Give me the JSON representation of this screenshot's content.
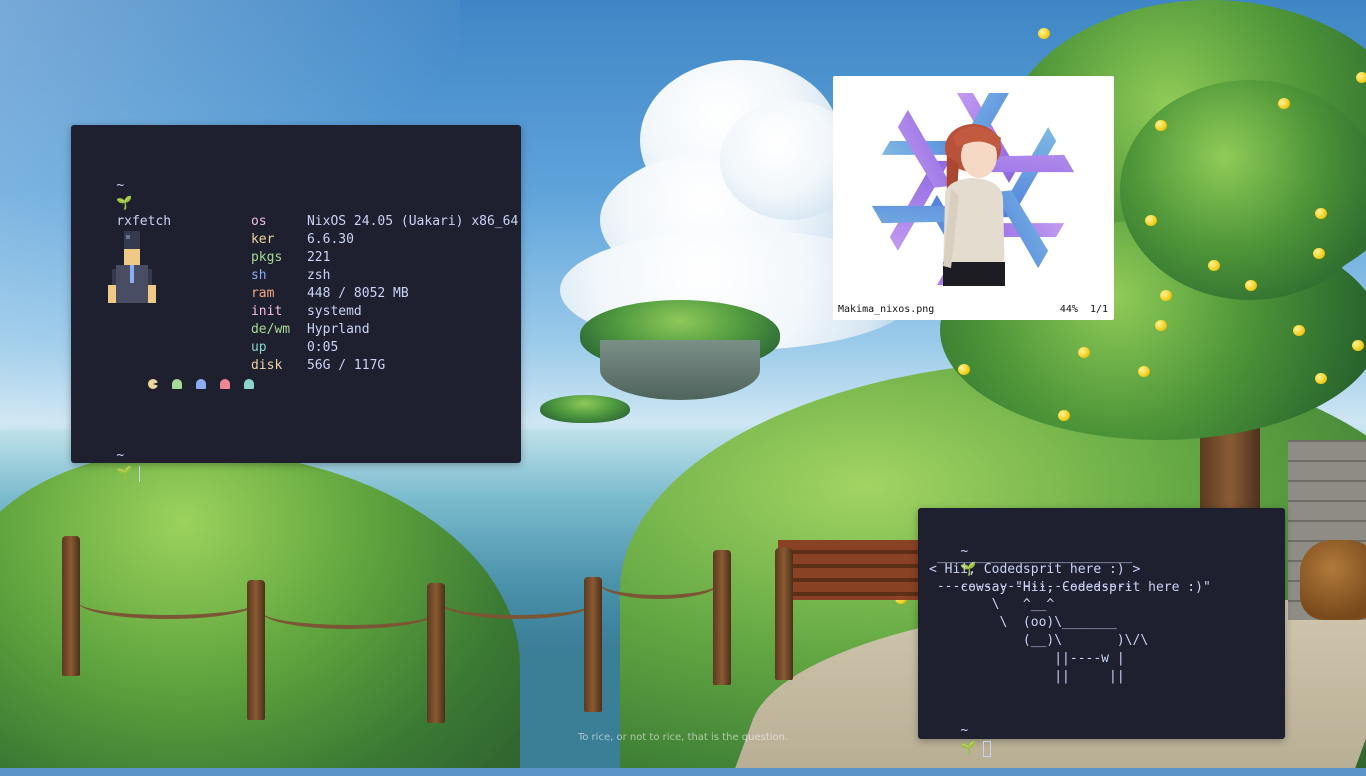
{
  "wallpaper": {
    "caption": "To rice, or not to rice, that is the question."
  },
  "terminal_fetch": {
    "prompt_symbol": "~",
    "prompt_icon": "sprout-icon",
    "command": "rxfetch",
    "info": [
      {
        "label": "os",
        "value": "NixOS 24.05 (Uakari) x86_64",
        "color": "#f5bde6"
      },
      {
        "label": "ker",
        "value": "6.6.30",
        "color": "#eed49f"
      },
      {
        "label": "pkgs",
        "value": "221",
        "color": "#a6da95"
      },
      {
        "label": "sh",
        "value": "zsh",
        "color": "#8aadf4"
      },
      {
        "label": "ram",
        "value": "448 / 8052 MB",
        "color": "#f5a97f"
      },
      {
        "label": "init",
        "value": "systemd",
        "color": "#f5bde6"
      },
      {
        "label": "de/wm",
        "value": "Hyprland",
        "color": "#a6da95"
      },
      {
        "label": "up",
        "value": "0:05",
        "color": "#8bd5ca"
      },
      {
        "label": "disk",
        "value": "56G / 117G",
        "color": "#eed49f"
      }
    ],
    "second_prompt_symbol": "~"
  },
  "image_viewer": {
    "filename": "Makima_nixos.png",
    "zoom": "44%",
    "index": "1/1"
  },
  "terminal_cowsay": {
    "prompt_symbol": "~",
    "command": "cowsay \"Hii, Codedsprit here :)\"",
    "cow_lines": [
      " _________________________",
      "< Hii, Codedsprit here :) >",
      " -------------------------",
      "        \\   ^__^",
      "         \\  (oo)\\_______",
      "            (__)\\       )\\/\\",
      "                ||----w |",
      "                ||     ||"
    ],
    "second_prompt_symbol": "~"
  },
  "colors": {
    "terminal_bg": "#1e2030",
    "terminal_fg": "#cad3f5",
    "accent_pink": "#ed8796"
  }
}
